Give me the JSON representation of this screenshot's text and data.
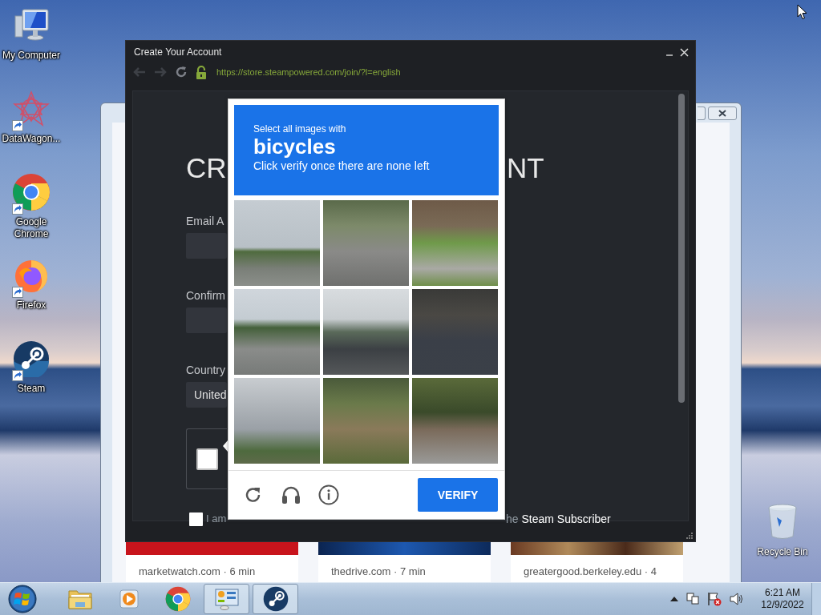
{
  "desktop_icons": [
    {
      "label": "My Computer",
      "kind": "computer",
      "shortcut": false
    },
    {
      "label": "DataWagon...",
      "kind": "datawagon",
      "shortcut": true
    },
    {
      "label": "Google Chrome",
      "kind": "chrome",
      "shortcut": true
    },
    {
      "label": "Firefox",
      "kind": "firefox",
      "shortcut": true
    },
    {
      "label": "Steam",
      "kind": "steam",
      "shortcut": true
    }
  ],
  "recycle_bin": {
    "label": "Recycle Bin"
  },
  "background_window": {
    "cards": [
      {
        "source": "marketwatch.com · 6 min"
      },
      {
        "source": "thedrive.com · 7 min"
      },
      {
        "source": "greatergood.berkeley.edu · 4"
      }
    ]
  },
  "steam_window": {
    "title": "Create Your Account",
    "url": "https://store.steampowered.com/join/?l=english",
    "heading_left": "CR",
    "heading_right": "NT",
    "fields": [
      {
        "label": "Email A",
        "kind": "input"
      },
      {
        "label": "Confirm",
        "kind": "input"
      },
      {
        "label": "Country",
        "kind": "select",
        "value": "United"
      }
    ],
    "recaptcha_checked": false,
    "agreement": {
      "checked": false,
      "text_left": "I am",
      "text_right": "he **Steam Subscriber**"
    }
  },
  "captcha": {
    "prompt": "Select all images with",
    "target": "bicycles",
    "instruction": "Click verify once there are none left",
    "tiles": [
      {
        "selected": false
      },
      {
        "selected": false
      },
      {
        "selected": false
      },
      {
        "selected": false
      },
      {
        "selected": false
      },
      {
        "selected": false
      },
      {
        "selected": false
      },
      {
        "selected": false
      },
      {
        "selected": false
      }
    ],
    "verify_button": "VERIFY"
  },
  "taskbar": {
    "apps": [
      {
        "kind": "explorer",
        "active": false
      },
      {
        "kind": "media",
        "active": false
      },
      {
        "kind": "chrome",
        "active": false
      },
      {
        "kind": "control",
        "active": true
      },
      {
        "kind": "steam",
        "active": true
      }
    ],
    "time": "6:21 AM",
    "date": "12/9/2022"
  }
}
